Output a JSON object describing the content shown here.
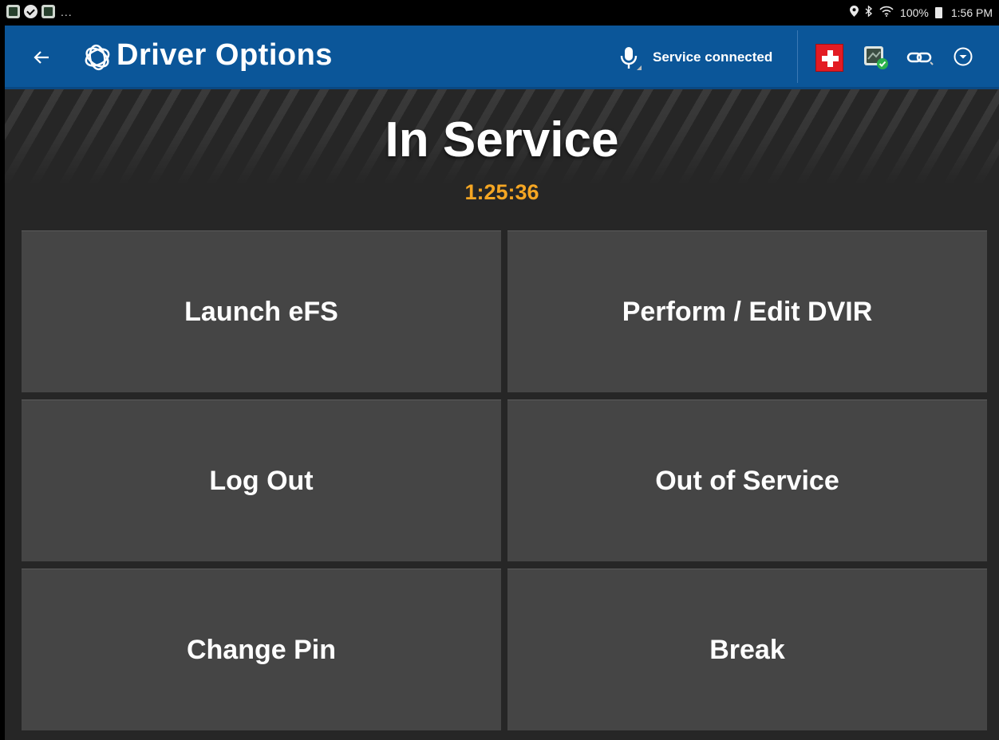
{
  "status_bar": {
    "left_icons": [
      "gallery-icon",
      "check-circle-icon",
      "gallery-icon"
    ],
    "more": "...",
    "right_icons": [
      "location-pin-icon",
      "bluetooth-icon",
      "wifi-icon",
      "battery-icon"
    ],
    "battery": "100%",
    "time": "1:56 PM"
  },
  "app_bar": {
    "back_icon": "arrow-left-icon",
    "logo_icon": "trimble-globe-icon",
    "title": "Driver Options",
    "mic_icon": "microphone-icon",
    "service_status": "Service connected",
    "actions": [
      "medic-cross-icon",
      "device-check-icon",
      "link-icon",
      "chevron-down-circle-icon"
    ],
    "colors": {
      "bar": "#0b5699",
      "medic": "#e31b23"
    }
  },
  "main": {
    "status": "In Service",
    "timer": "1:25:36",
    "timer_color": "#f5a623",
    "tiles": [
      {
        "label": "Launch eFS"
      },
      {
        "label": "Perform / Edit DVIR"
      },
      {
        "label": "Log Out"
      },
      {
        "label": "Out of Service"
      },
      {
        "label": "Change Pin"
      },
      {
        "label": "Break"
      }
    ]
  }
}
